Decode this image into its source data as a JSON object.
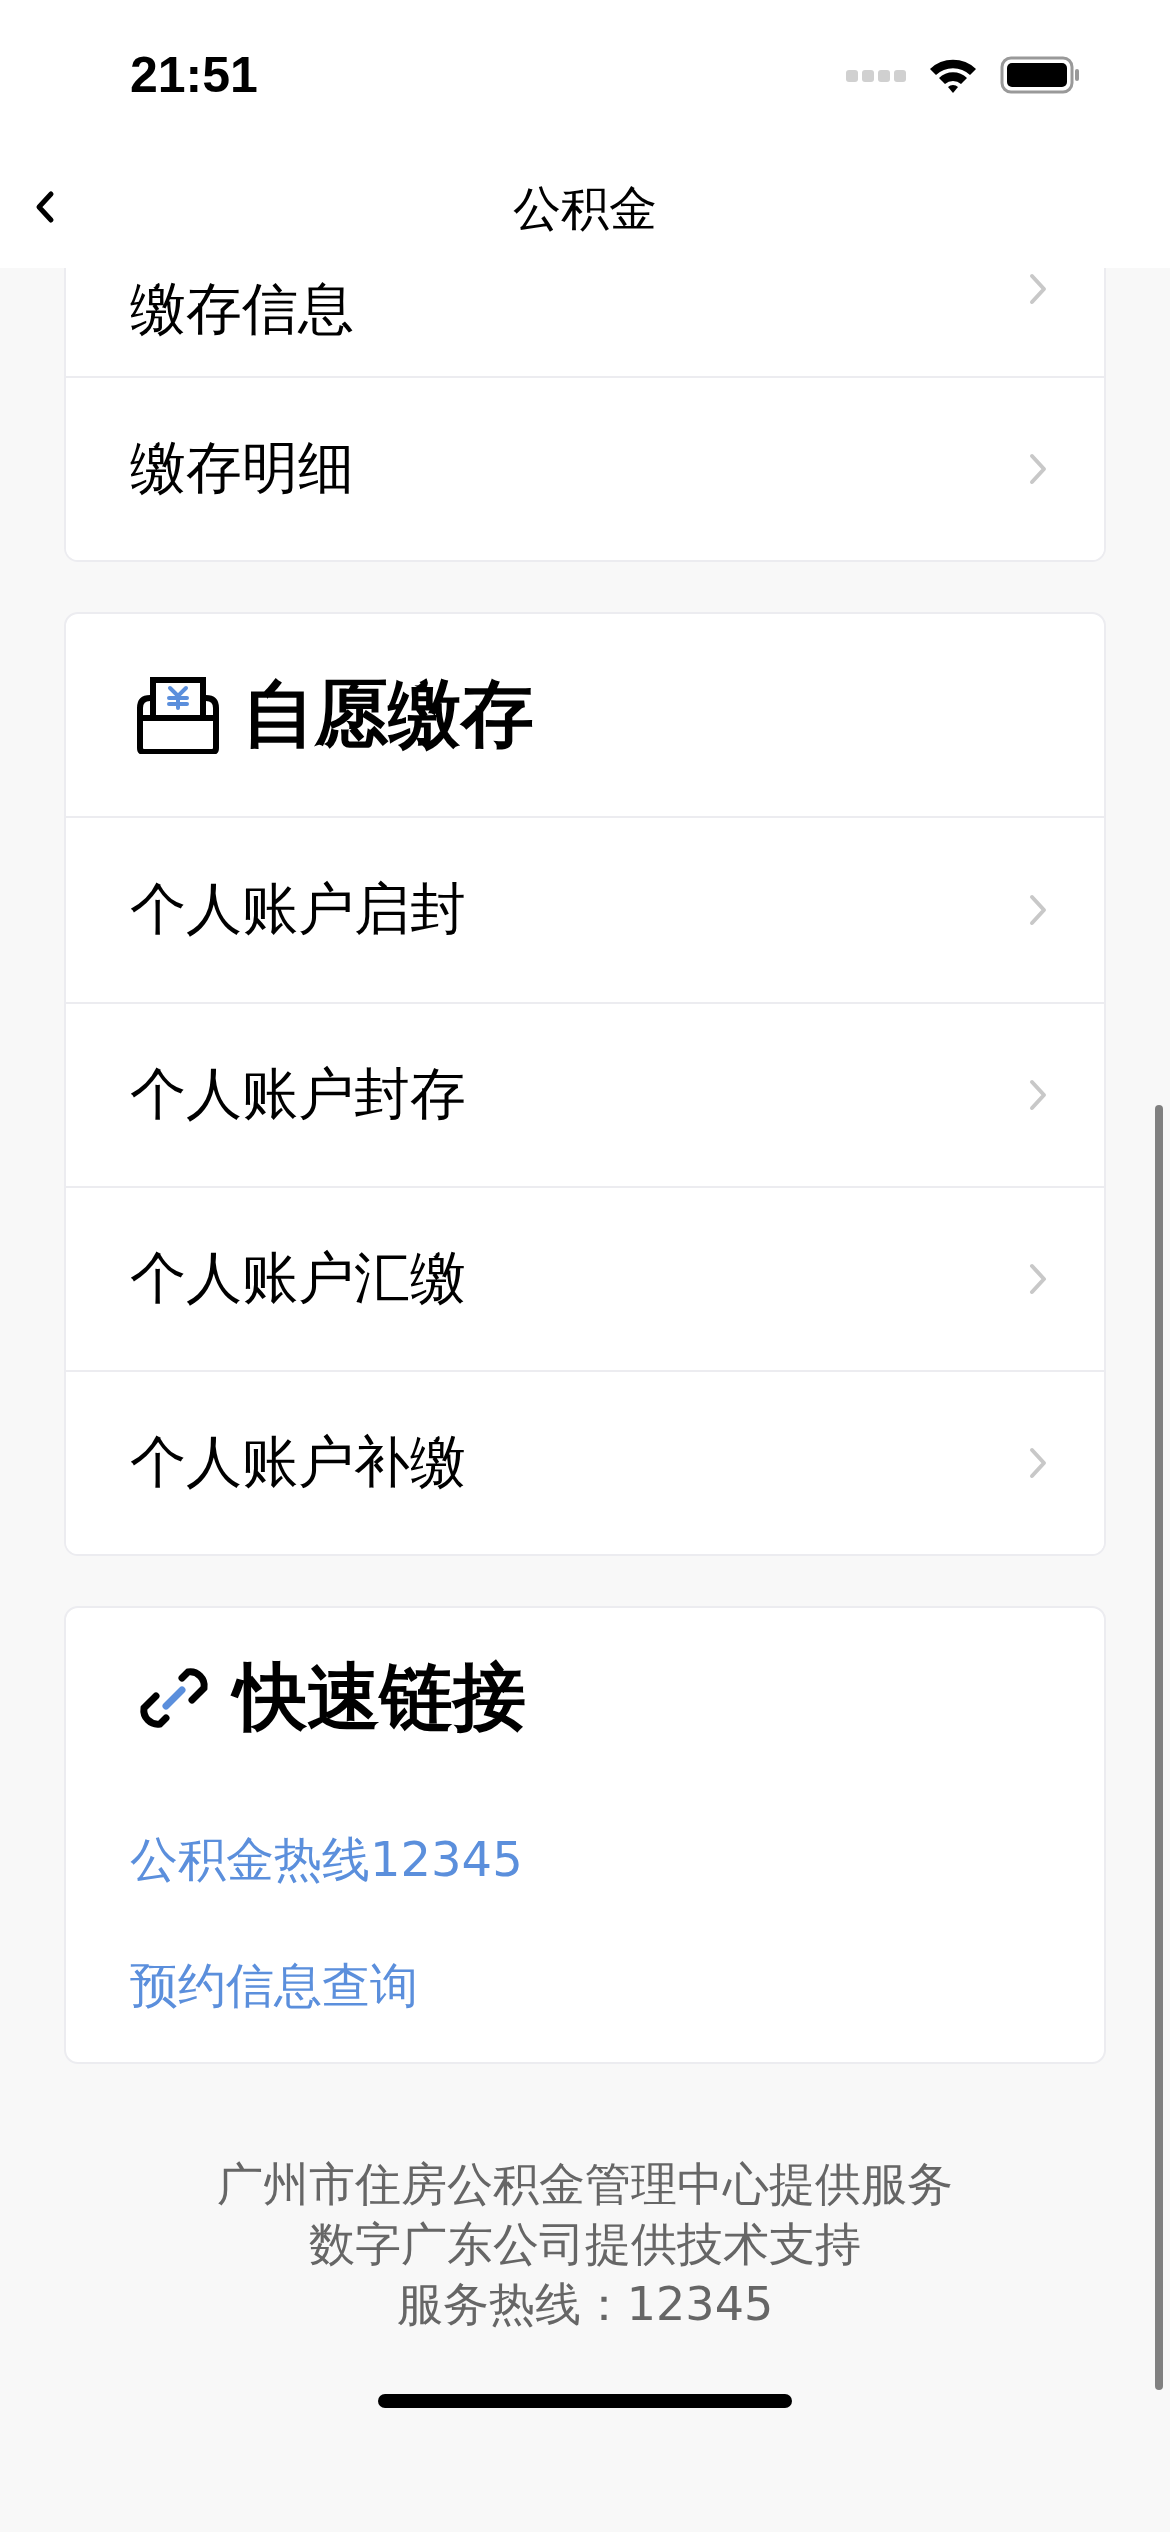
{
  "status_bar": {
    "time": "21:51"
  },
  "nav": {
    "title": "公积金"
  },
  "sections": [
    {
      "kind": "menu",
      "items": [
        "缴存信息",
        "缴存明细"
      ]
    },
    {
      "kind": "menu",
      "title": "自愿缴存",
      "items": [
        "个人账户启封",
        "个人账户封存",
        "个人账户汇缴",
        "个人账户补缴"
      ]
    },
    {
      "kind": "links",
      "title": "快速链接",
      "items": [
        "公积金热线12345",
        "预约信息查询"
      ]
    }
  ],
  "footer": [
    "广州市住房公积金管理中心提供服务",
    "数字广东公司提供技术支持",
    "服务热线：12345"
  ]
}
